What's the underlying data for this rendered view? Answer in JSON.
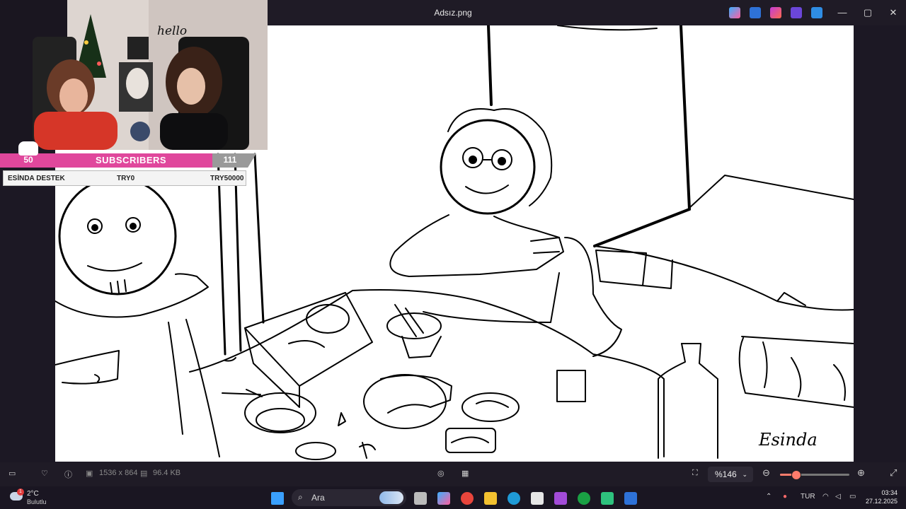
{
  "window": {
    "title": "Adsız.png",
    "controls": {
      "minimize": "—",
      "maximize": "▢",
      "close": "✕"
    }
  },
  "overlay": {
    "subscribers": {
      "count": "50",
      "label": "SUBSCRIBERS",
      "goal": "111"
    },
    "donation": {
      "name": "ESİNDA DESTEK",
      "current": "TRY0",
      "goal": "TRY50000"
    },
    "webcam_decor_text": "hello"
  },
  "drawing": {
    "signature": "Esinda"
  },
  "viewer_toolbar": {
    "dimensions": "1536 x 864",
    "file_size": "96.4 KB",
    "zoom_value": "%146",
    "zoom_level_fraction": 0.22
  },
  "taskbar": {
    "weather": {
      "temp": "2°C",
      "desc": "Bulutlu",
      "badge": "1"
    },
    "search_placeholder": "Ara",
    "language": "TUR",
    "time": "03:34",
    "date": "27.12.2025"
  },
  "icons": [
    "display-icon",
    "heart-icon",
    "info-icon",
    "image-size-icon",
    "save-size-icon",
    "visual-search-icon",
    "ocr-icon",
    "fit-icon",
    "chevron-down-icon",
    "zoom-out-icon",
    "zoom-in-icon",
    "fullscreen-icon",
    "windows-start-icon",
    "search-icon",
    "chevron-up-icon",
    "mic-icon",
    "wifi-icon",
    "volume-icon",
    "battery-icon"
  ],
  "colors": {
    "subscriber_pink": "#e0479c",
    "accent_coral": "#ff7c6c",
    "titlebar_bg": "#1f1b26"
  }
}
